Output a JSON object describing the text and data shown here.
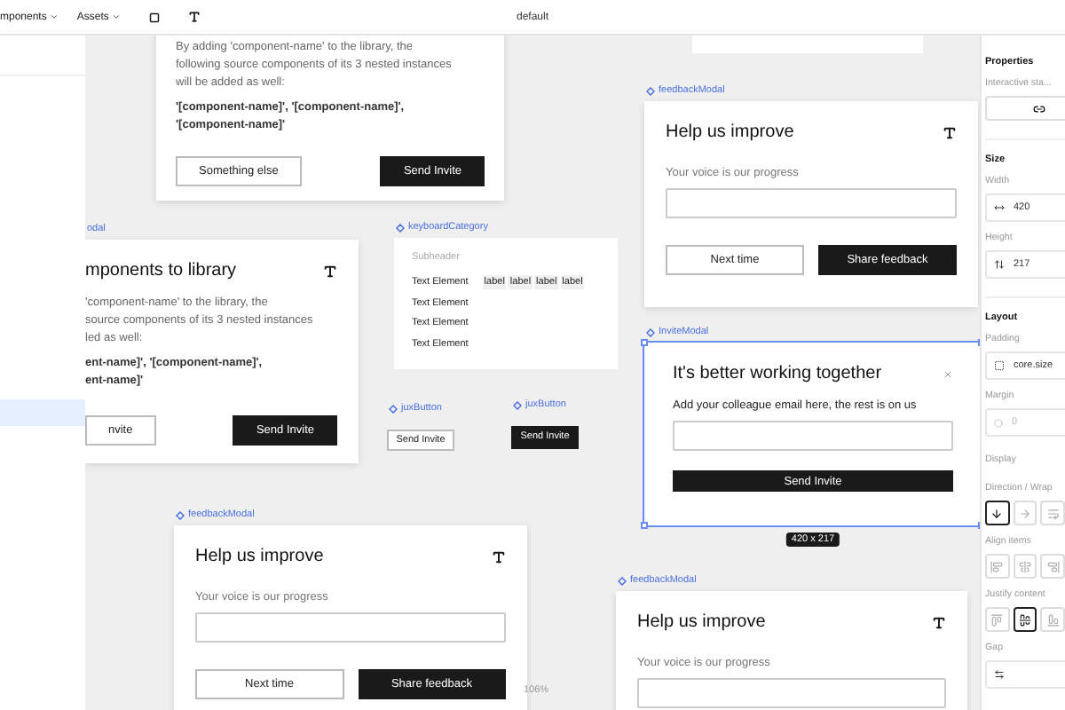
{
  "toolbar": {
    "menus": [
      "mponents",
      "Assets"
    ],
    "title": "default"
  },
  "sidebar": {
    "rows": [
      {
        "selected": true
      }
    ]
  },
  "canvas": {
    "frames": [
      {
        "kind": "library_modal",
        "selected": false,
        "paragraph": [
          "By adding 'component-name' to the library, the",
          "following source components of its 3 nested instances",
          "will be added as well:"
        ],
        "names": [
          "'[component-name]', '[component-name]',",
          "'[component-name]'"
        ],
        "buttons": [
          {
            "label": "Something else",
            "primary": false
          },
          {
            "label": "Send Invite",
            "primary": true
          }
        ]
      },
      {
        "kind": "library_modal",
        "selected": false,
        "label": "odal",
        "title": "mponents to library",
        "paragraph": [
          "'component-name' to the library, the",
          "source components of its 3 nested instances",
          "led as well:"
        ],
        "names": [
          "ent-name]', '[component-name]',",
          "ent-name]'"
        ],
        "buttons": [
          {
            "label": "nvite",
            "primary": false
          },
          {
            "label": "Send Invite",
            "primary": true
          }
        ]
      },
      {
        "kind": "list",
        "selected": false,
        "label": "keyboardCategory",
        "subheader": "Subheader",
        "rows": [
          {
            "text": "Text Element",
            "tags": [
              "label",
              "label",
              "label",
              "label"
            ]
          },
          {
            "text": "Text Element"
          },
          {
            "text": "Text Element"
          },
          {
            "text": "Text Element"
          }
        ]
      },
      {
        "kind": "button",
        "label": "juxButton",
        "text": "Send Invite",
        "primary": false
      },
      {
        "kind": "button",
        "label": "juxButton",
        "text": "Send Invite",
        "primary": true
      },
      {
        "kind": "feedback_modal",
        "selected": false,
        "label": "feedbackModal",
        "title": "Help us improve",
        "prompt": "Your voice is our progress",
        "buttons": [
          {
            "label": "Next time",
            "primary": false
          },
          {
            "label": "Share feedback",
            "primary": true
          }
        ]
      },
      {
        "kind": "invite_modal",
        "selected": true,
        "label": "InviteModal",
        "title": "It's better working together",
        "prompt": "Add your colleague email here, the rest is on us",
        "buttons": [
          {
            "label": "Send Invite",
            "primary": true
          }
        ],
        "size": "420 x 217"
      },
      {
        "kind": "feedback_modal",
        "selected": false,
        "label": "feedbackModal",
        "title": "Help us improve",
        "prompt": "Your voice is our progress",
        "buttons": [
          {
            "label": "Next time",
            "primary": false
          },
          {
            "label": "Share feedback",
            "primary": true
          }
        ]
      },
      {
        "kind": "feedback_modal",
        "selected": false,
        "label": "feedbackModal",
        "title": "Help us improve",
        "prompt": "Your voice is our progress"
      }
    ],
    "zoom": "106%"
  },
  "panel": {
    "title": "Properties",
    "interactive": {
      "label": "Interactive sta..."
    },
    "size": {
      "title": "Size",
      "width": {
        "label": "Width",
        "value": "420"
      },
      "height": {
        "label": "Height",
        "value": "217"
      }
    },
    "layout": {
      "title": "Layout",
      "padding": {
        "label": "Padding",
        "value": "core.size"
      },
      "margin": {
        "label": "Margin",
        "value": "0"
      },
      "display": "Display",
      "direction": {
        "label": "Direction / Wrap",
        "options": [
          {
            "selected": true
          },
          {
            "selected": false
          },
          {
            "selected": false
          }
        ]
      },
      "align": {
        "label": "Align items",
        "options": [
          {
            "selected": false
          },
          {
            "selected": false
          },
          {
            "selected": false
          }
        ]
      },
      "justify": {
        "label": "Justify content",
        "options": [
          {
            "selected": false
          },
          {
            "selected": true
          },
          {
            "selected": false
          }
        ]
      },
      "gap": {
        "label": "Gap"
      }
    }
  }
}
